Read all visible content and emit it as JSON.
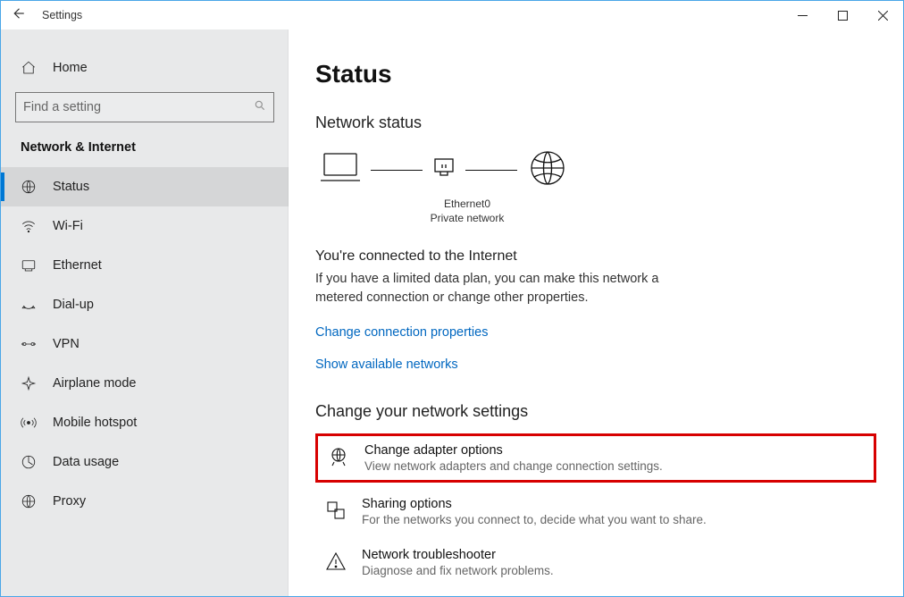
{
  "window": {
    "title": "Settings"
  },
  "sidebar": {
    "home": "Home",
    "search_placeholder": "Find a setting",
    "section": "Network & Internet",
    "items": [
      {
        "label": "Status"
      },
      {
        "label": "Wi-Fi"
      },
      {
        "label": "Ethernet"
      },
      {
        "label": "Dial-up"
      },
      {
        "label": "VPN"
      },
      {
        "label": "Airplane mode"
      },
      {
        "label": "Mobile hotspot"
      },
      {
        "label": "Data usage"
      },
      {
        "label": "Proxy"
      }
    ]
  },
  "main": {
    "title": "Status",
    "network_status_heading": "Network status",
    "diagram": {
      "adapter_name": "Ethernet0",
      "network_type": "Private network"
    },
    "connected_title": "You're connected to the Internet",
    "connected_desc": "If you have a limited data plan, you can make this network a metered connection or change other properties.",
    "link_change_props": "Change connection properties",
    "link_show_networks": "Show available networks",
    "change_settings_heading": "Change your network settings",
    "options": [
      {
        "title": "Change adapter options",
        "desc": "View network adapters and change connection settings."
      },
      {
        "title": "Sharing options",
        "desc": "For the networks you connect to, decide what you want to share."
      },
      {
        "title": "Network troubleshooter",
        "desc": "Diagnose and fix network problems."
      }
    ]
  }
}
